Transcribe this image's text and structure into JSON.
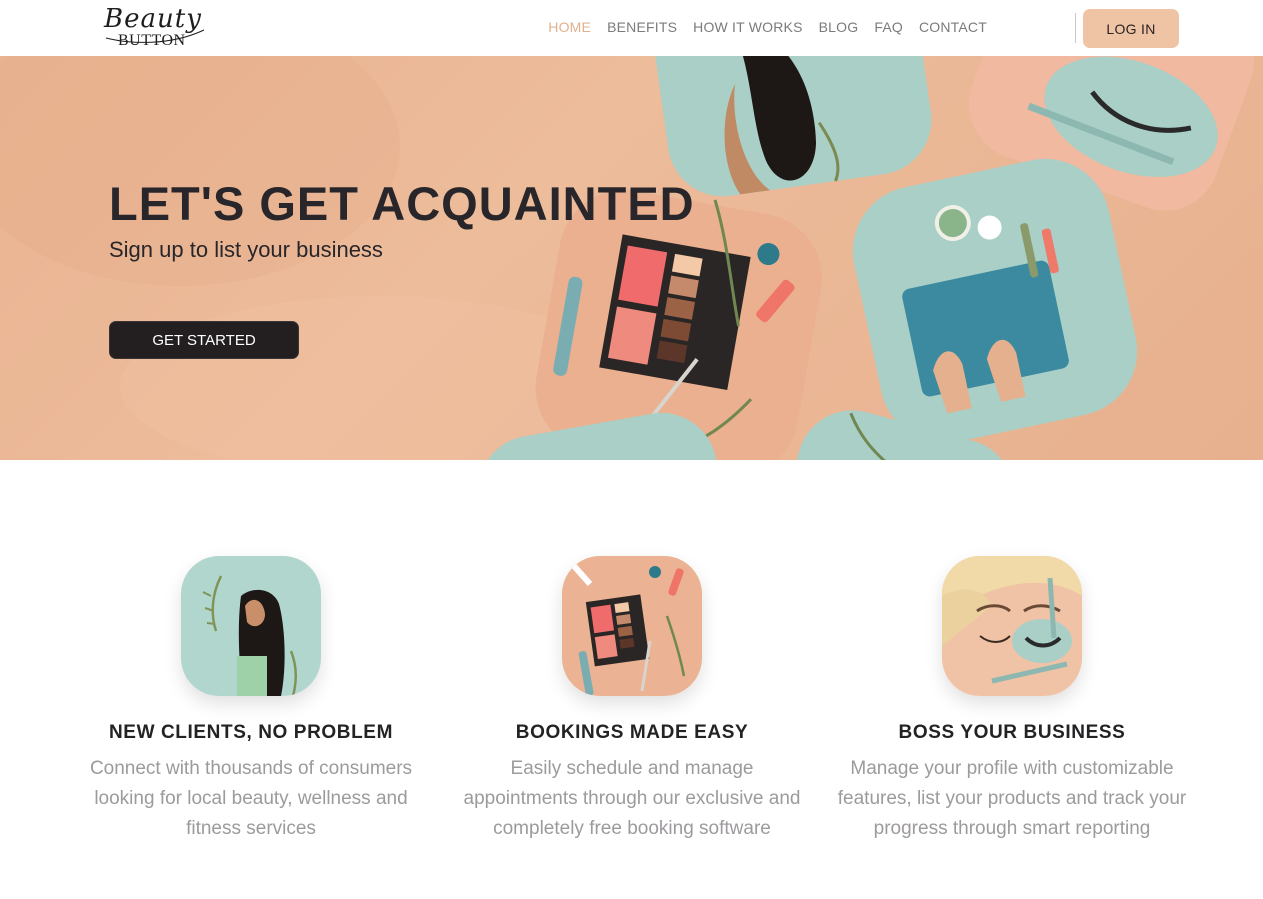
{
  "brand": {
    "logo_script": "Beauty",
    "logo_word": "BUTTON"
  },
  "nav": {
    "items": [
      {
        "label": "HOME",
        "active": true
      },
      {
        "label": "BENEFITS",
        "active": false
      },
      {
        "label": "HOW IT WORKS",
        "active": false
      },
      {
        "label": "BLOG",
        "active": false
      },
      {
        "label": "FAQ",
        "active": false
      },
      {
        "label": "CONTACT",
        "active": false
      }
    ],
    "login_label": "LOG IN"
  },
  "hero": {
    "title": "LET'S GET ACQUAINTED",
    "subtitle": "Sign up to list your business",
    "cta_label": "GET STARTED"
  },
  "features": [
    {
      "title": "NEW CLIENTS, NO PROBLEM",
      "text": "Connect with thousands of consumers looking for local beauty, wellness and fitness services",
      "icon": "woman-portrait-icon"
    },
    {
      "title": "BOOKINGS MADE EASY",
      "text": "Easily schedule and manage appointments through our exclusive and completely free booking software",
      "icon": "makeup-palette-icon"
    },
    {
      "title": "BOSS YOUR BUSINESS",
      "text": "Manage your profile with customizable features, list your products and track your progress through smart reporting",
      "icon": "lash-treatment-icon"
    }
  ],
  "colors": {
    "accent": "#efc4a5",
    "nav_active": "#e0b28f",
    "hero_bg": "#eab795",
    "dark": "#231f21",
    "mint": "#a9cfc6"
  }
}
